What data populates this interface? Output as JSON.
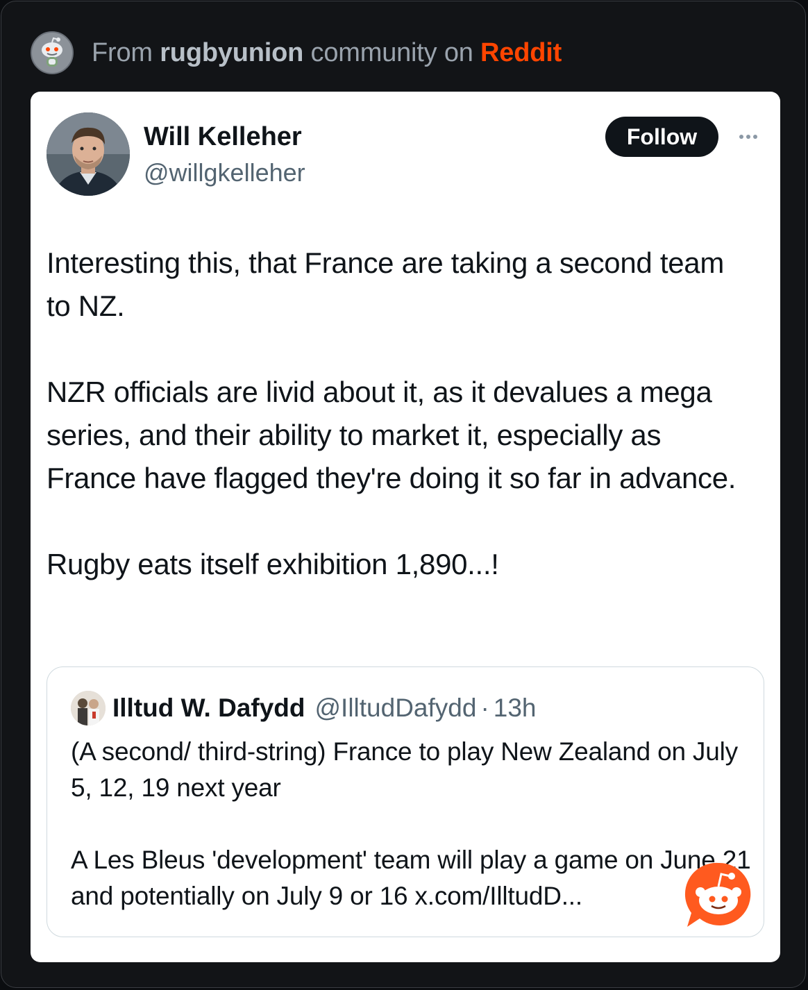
{
  "header": {
    "prefix": "From",
    "community": "rugbyunion",
    "middle": "community on",
    "platform": "Reddit",
    "avatar_icon": "reddit-snoo-icon"
  },
  "tweet": {
    "author_name": "Will Kelleher",
    "author_handle": "@willgkelleher",
    "follow_label": "Follow",
    "more_icon": "more-dots-icon",
    "paragraphs": [
      "Interesting this, that France are taking a second team to NZ.",
      "NZR officials are livid about it, as it devalues a mega series, and their ability to market it, especially as France have flagged they're doing it so far in advance.",
      "Rugby eats itself exhibition 1,890...!"
    ]
  },
  "quoted": {
    "name": "Illtud W. Dafydd",
    "handle": "@IlltudDafydd",
    "separator": "·",
    "time": "13h",
    "paragraphs": [
      "(A second/ third-string) France to play New Zealand on July 5, 12, 19 next year",
      "A Les Bleus 'development' team will play a game on June 21 and potentially on July 9 or 16 x.com/IlltudD..."
    ]
  },
  "colors": {
    "reddit_orange": "#ff4500",
    "card_bg": "#ffffff",
    "page_bg": "#121417",
    "text_primary": "#0f1419",
    "text_secondary": "#536471"
  }
}
